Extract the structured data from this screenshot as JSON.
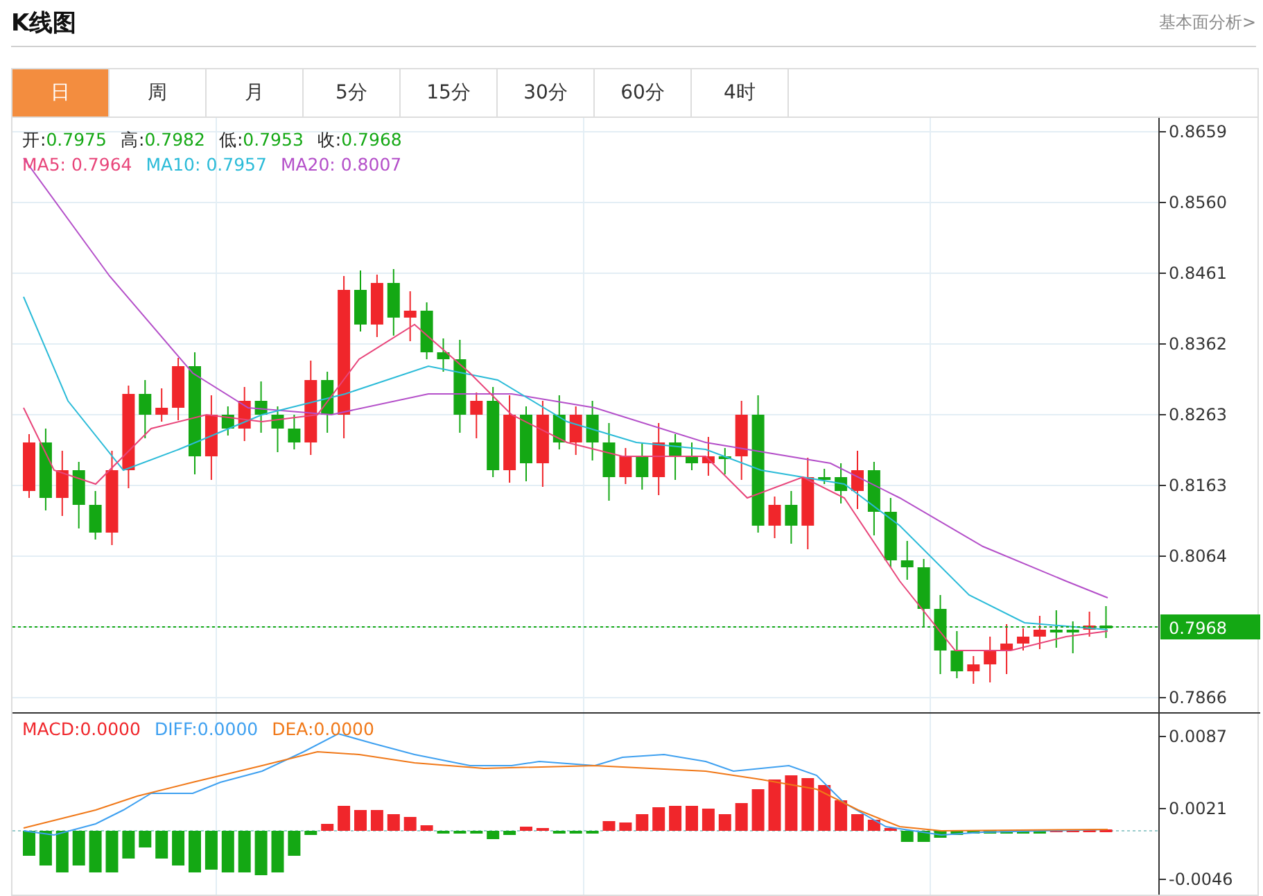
{
  "header": {
    "title": "K线图",
    "link": "基本面分析>"
  },
  "tabs": [
    {
      "label": "日",
      "selected": true
    },
    {
      "label": "周",
      "selected": false
    },
    {
      "label": "月",
      "selected": false
    },
    {
      "label": "5分",
      "selected": false
    },
    {
      "label": "15分",
      "selected": false
    },
    {
      "label": "30分",
      "selected": false
    },
    {
      "label": "60分",
      "selected": false
    },
    {
      "label": "4时",
      "selected": false
    }
  ],
  "price_legend": [
    {
      "label": "开:",
      "value": "0.7975"
    },
    {
      "label": "高:",
      "value": "0.7982"
    },
    {
      "label": "低:",
      "value": "0.7953"
    },
    {
      "label": "收:",
      "value": "0.7968"
    }
  ],
  "ma_legend": [
    {
      "label": "MA5:",
      "value": "0.7964",
      "color": "#e8457a"
    },
    {
      "label": "MA10:",
      "value": "0.7957",
      "color": "#2bbbd8"
    },
    {
      "label": "MA20:",
      "value": "0.8007",
      "color": "#b44fc9"
    }
  ],
  "price_axis": [
    "0.8659",
    "0.8560",
    "0.8461",
    "0.8362",
    "0.8263",
    "0.8163",
    "0.8064",
    "0.7866"
  ],
  "current_price": "0.7968",
  "macd_legend": [
    {
      "label": "MACD:",
      "value": "0.0000",
      "color": "#f0262b"
    },
    {
      "label": "DIFF:",
      "value": "0.0000",
      "color": "#3ea0f0"
    },
    {
      "label": "DEA:",
      "value": "0.0000",
      "color": "#f07818"
    }
  ],
  "macd_axis": [
    "0.0087",
    "0.0021",
    "-0.0046"
  ]
}
